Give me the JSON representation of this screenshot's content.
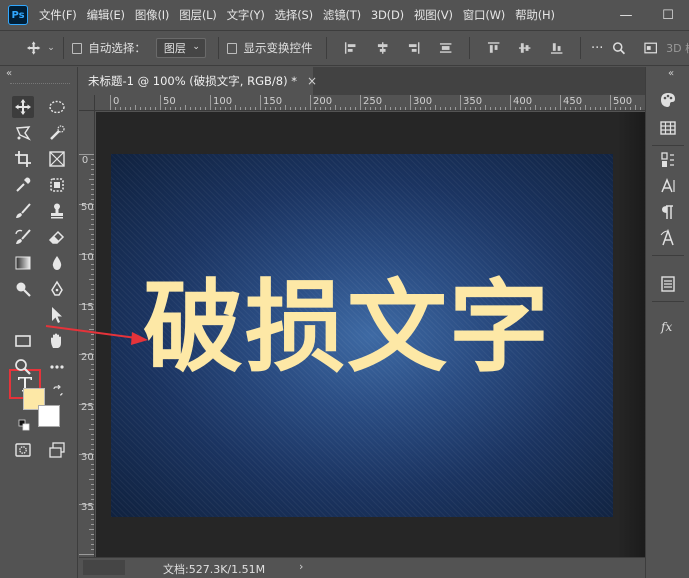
{
  "app": {
    "logo": "Ps"
  },
  "menu": [
    "文件(F)",
    "编辑(E)",
    "图像(I)",
    "图层(L)",
    "文字(Y)",
    "选择(S)",
    "滤镜(T)",
    "3D(D)",
    "视图(V)",
    "窗口(W)",
    "帮助(H)"
  ],
  "window_controls": {
    "minimize": "—",
    "maximize": "☐"
  },
  "options": {
    "auto_select_label": "自动选择：",
    "layer_select_value": "图层",
    "show_transform_label": "显示变换控件",
    "mode_3d_label": "3D 模"
  },
  "document": {
    "tab_title": "未标题-1 @ 100% (破损文字, RGB/8) *",
    "close": "×",
    "canvas_text": "破损文字"
  },
  "ruler_top_labels": [
    "0",
    "50",
    "100",
    "150",
    "200",
    "250",
    "300",
    "350",
    "400",
    "450",
    "500"
  ],
  "ruler_left_labels": [
    "0",
    "50",
    "100",
    "150",
    "200",
    "250",
    "300",
    "350"
  ],
  "status": {
    "doc_info": "文档:527.3K/1.51M",
    "arrow": "›"
  },
  "colors": {
    "foreground": "#fde8a6",
    "background": "#ffffff",
    "highlight": "#e5333a",
    "text_color": "#fde8a6"
  },
  "tools": [
    "move-tool",
    "marquee-tool",
    "lasso-tool",
    "quick-selection-tool",
    "crop-tool",
    "frame-tool",
    "eyedropper-tool",
    "healing-brush-tool",
    "brush-tool",
    "clone-stamp-tool",
    "history-brush-tool",
    "eraser-tool",
    "gradient-tool",
    "blur-tool",
    "dodge-tool",
    "pen-tool",
    "type-tool",
    "path-selection-tool",
    "rectangle-tool",
    "hand-tool",
    "zoom-tool",
    "more-tools"
  ],
  "right_panels": [
    "color-panel",
    "swatches-panel",
    "adjustments-panel",
    "character-panel",
    "paragraph-panel",
    "glyphs-panel",
    "properties-panel",
    "styles-panel"
  ]
}
